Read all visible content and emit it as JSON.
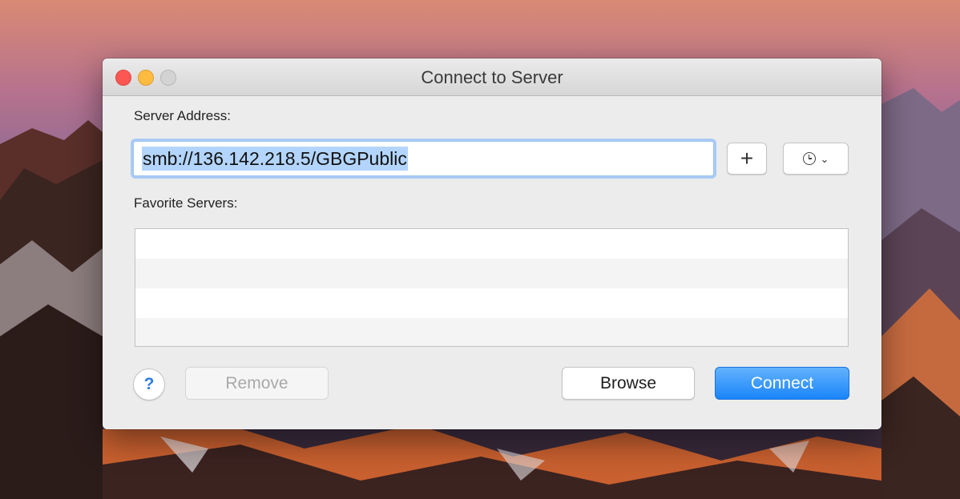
{
  "window": {
    "title": "Connect to Server"
  },
  "server": {
    "label": "Server Address:",
    "address": "smb://136.142.218.5/GBGPublic"
  },
  "toolbar": {
    "add_label": "+",
    "recent_chevron": "⌄"
  },
  "favorites": {
    "label": "Favorite Servers:",
    "items": []
  },
  "buttons": {
    "help_label": "?",
    "remove_label": "Remove",
    "browse_label": "Browse",
    "connect_label": "Connect"
  },
  "colors": {
    "accent": "#1a85f9",
    "close": "#fc5753",
    "minimize": "#fdbc40",
    "zoom_disabled": "#d3d3d3",
    "selection": "#b3d5fd"
  },
  "icons": {
    "add": "plus-icon",
    "recent": "clock-icon",
    "help": "question-mark-icon"
  }
}
